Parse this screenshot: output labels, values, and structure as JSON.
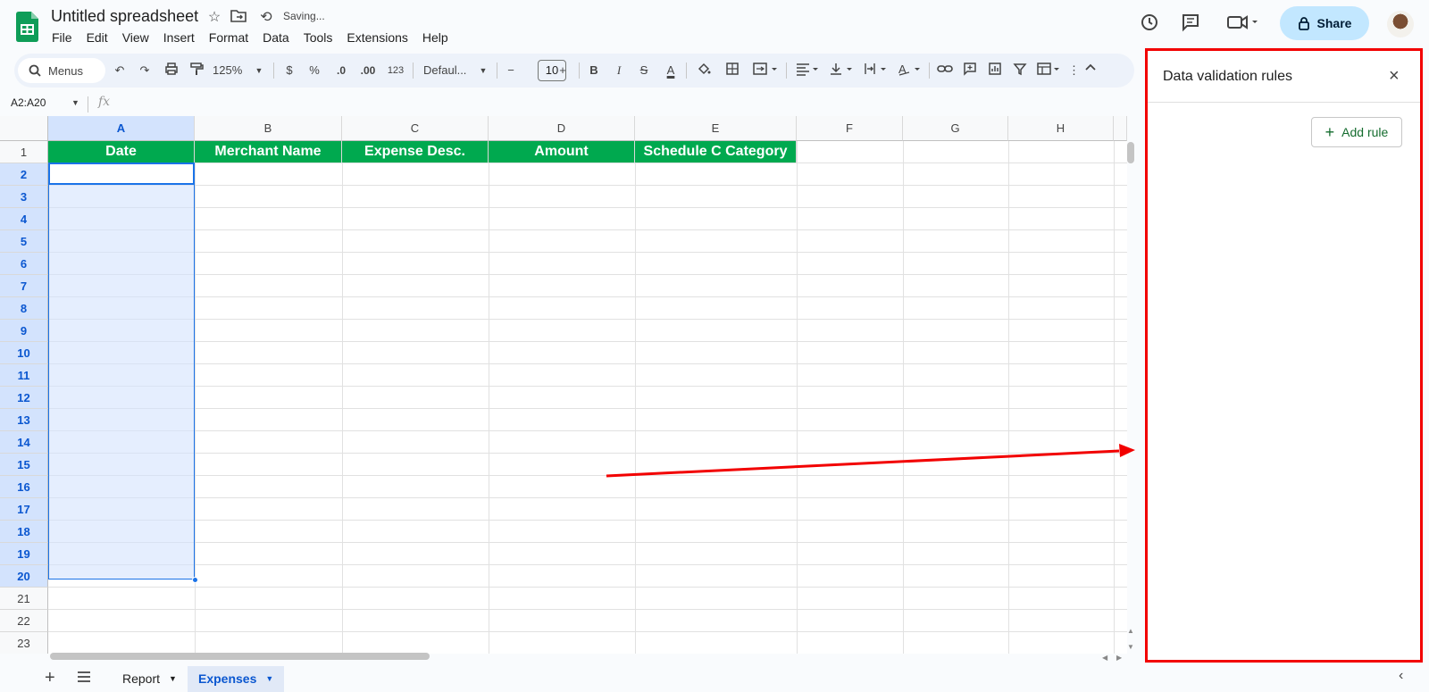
{
  "app": {
    "doc_title": "Untitled spreadsheet",
    "status": "Saving...",
    "menu": [
      "File",
      "Edit",
      "View",
      "Insert",
      "Format",
      "Data",
      "Tools",
      "Extensions",
      "Help"
    ],
    "share_label": "Share"
  },
  "toolbar": {
    "search_label": "Menus",
    "zoom": "125%",
    "currency": "$",
    "percent": "%",
    "dec_decrease": ".0",
    "dec_increase": ".00",
    "number_format": "123",
    "font": "Defaul...",
    "font_size": "10"
  },
  "formula_bar": {
    "name_box": "A2:A20",
    "fx": "fx"
  },
  "grid": {
    "columns": [
      "A",
      "B",
      "C",
      "D",
      "E",
      "F",
      "G",
      "H"
    ],
    "rows": [
      "1",
      "2",
      "3",
      "4",
      "5",
      "6",
      "7",
      "8",
      "9",
      "10",
      "11",
      "12",
      "13",
      "14",
      "15",
      "16",
      "17",
      "18",
      "19",
      "20",
      "21",
      "22",
      "23"
    ],
    "header_row": [
      "Date",
      "Merchant Name",
      "Expense Desc.",
      "Amount",
      "Schedule C Category"
    ],
    "header_color": "#00a94f",
    "selected_range": "A2:A20"
  },
  "sheets": {
    "tabs": [
      {
        "label": "Report",
        "active": false
      },
      {
        "label": "Expenses",
        "active": true
      }
    ]
  },
  "panel": {
    "title": "Data validation rules",
    "add_rule_label": "Add rule",
    "highlight_color": "#f20000"
  }
}
